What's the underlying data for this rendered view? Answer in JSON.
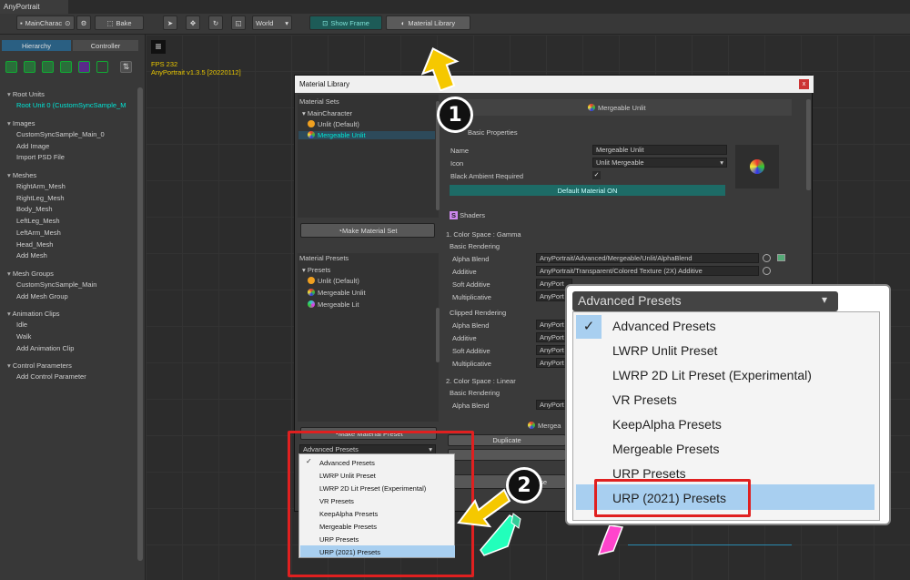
{
  "app": {
    "tab": "AnyPortrait"
  },
  "toolbar": {
    "target": "MainCharac",
    "bake": "Bake",
    "space": "World",
    "show_frame": "Show Frame",
    "material_library": "Material Library"
  },
  "left": {
    "tabs": [
      "Hierarchy",
      "Controller"
    ],
    "sections": {
      "root_units": "Root Units",
      "root_unit_0": "Root Unit 0 (CustomSyncSample_M",
      "images": "Images",
      "image_0": "CustomSyncSample_Main_0",
      "add_image": "Add Image",
      "import_psd": "Import PSD File",
      "meshes": "Meshes",
      "mesh_items": [
        "RightArm_Mesh",
        "RightLeg_Mesh",
        "Body_Mesh",
        "LeftLeg_Mesh",
        "LeftArm_Mesh",
        "Head_Mesh"
      ],
      "add_mesh": "Add Mesh",
      "mesh_groups": "Mesh Groups",
      "mesh_group_0": "CustomSyncSample_Main",
      "add_mesh_group": "Add Mesh Group",
      "anim_clips": "Animation Clips",
      "anim_items": [
        "Idle",
        "Walk"
      ],
      "add_anim": "Add Animation Clip",
      "control_params": "Control Parameters",
      "add_control": "Add Control Parameter"
    }
  },
  "viewport": {
    "fps": "FPS 232",
    "version": "AnyPortrait v1.3.5 [20220112]"
  },
  "dialog": {
    "title": "Material Library",
    "close": "x",
    "material_sets_label": "Material Sets",
    "sets_root": "MainCharacter",
    "sets": [
      "Unlit (Default)",
      "Mergeable Unlit"
    ],
    "make_material_set": "Make Material Set",
    "material_presets_label": "Material Presets",
    "presets_root": "Presets",
    "presets": [
      "Unlit (Default)",
      "Mergeable Unlit",
      "Mergeable Lit"
    ],
    "make_material_preset": "Make Material Preset",
    "preset_dropdown": "Advanced Presets",
    "header_name": "Mergeable Unlit",
    "basic_properties": "Basic Properties",
    "name_label": "Name",
    "name_value": "Mergeable Unlit",
    "icon_label": "Icon",
    "icon_value": "Unlit Mergeable",
    "black_ambient": "Black Ambient Required",
    "default_material_on": "Default Material ON",
    "shaders": "Shaders",
    "gamma": "1. Color Space : Gamma",
    "basic_rendering": "Basic Rendering",
    "alpha_blend": "Alpha Blend",
    "additive": "Additive",
    "soft_additive": "Soft Additive",
    "multiplicative": "Multiplicative",
    "shader_paths": [
      "AnyPortrait/Advanced/Mergeable/Unlit/AlphaBlend",
      "AnyPortrait/Transparent/Colored Texture (2X) Additive",
      "AnyPort",
      "AnyPort"
    ],
    "clipped_rendering": "Clipped Rendering",
    "clipped_paths": [
      "AnyPort",
      "AnyPort",
      "AnyPort",
      "AnyPort"
    ],
    "linear": "2. Color Space : Linear",
    "linear_alpha": "AnyPort",
    "footer_name": "Mergea",
    "duplicate": "Duplicate",
    "close_btn": "ose"
  },
  "big_popup": {
    "header": "Advanced Presets",
    "items": [
      "Advanced Presets",
      "LWRP Unlit Preset",
      "LWRP 2D Lit Preset (Experimental)",
      "VR Presets",
      "KeepAlpha Presets",
      "Mergeable Presets",
      "URP Presets",
      "URP (2021) Presets"
    ]
  },
  "small_popup": {
    "items": [
      "Advanced Presets",
      "LWRP Unlit Preset",
      "LWRP 2D Lit Preset (Experimental)",
      "VR Presets",
      "KeepAlpha Presets",
      "Mergeable Presets",
      "URP Presets",
      "URP (2021) Presets"
    ]
  },
  "annotations": {
    "step1": "1",
    "step2": "2"
  },
  "colors": {
    "accent_cyan": "#00e5d5",
    "highlight": "#a8cff0",
    "red": "#e02020",
    "arrow": "#f5c800"
  }
}
